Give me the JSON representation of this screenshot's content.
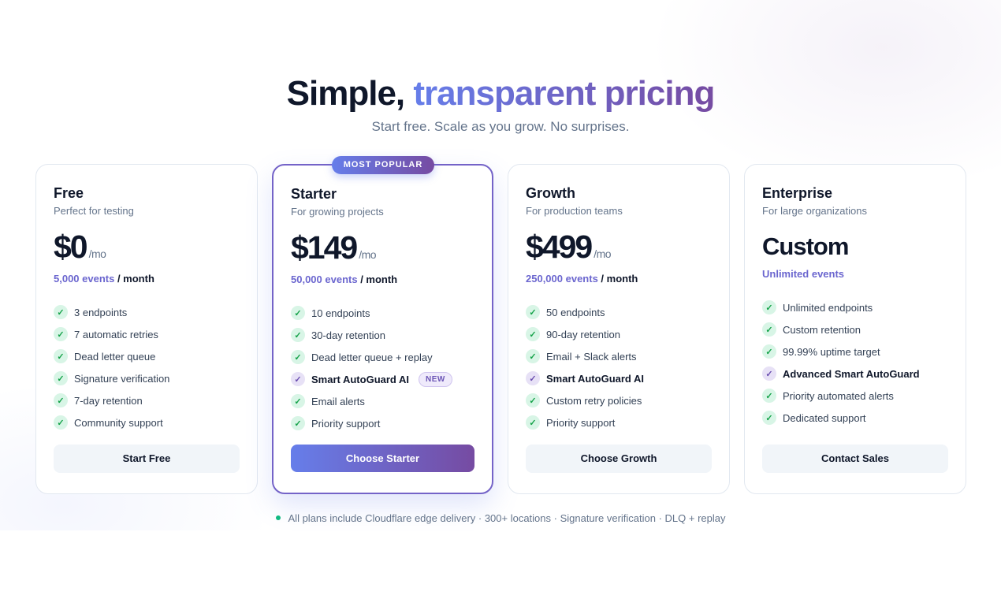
{
  "header": {
    "title_part1": "Simple, ",
    "title_part2": "transparent pricing",
    "subtitle": "Start free. Scale as you grow. No surprises."
  },
  "plans": [
    {
      "name": "Free",
      "description": "Perfect for testing",
      "price": "$0",
      "per": "/mo",
      "events_count": "5,000 events",
      "events_period": " / month",
      "features": [
        "3 endpoints",
        "7 automatic retries",
        "Dead letter queue",
        "Signature verification",
        "7-day retention",
        "Community support"
      ],
      "cta": "Start Free"
    },
    {
      "name": "Starter",
      "badge": "MOST POPULAR",
      "description": "For growing projects",
      "price": "$149",
      "per": "/mo",
      "events_count": "50,000 events",
      "events_period": " / month",
      "features": [
        "10 endpoints",
        "30-day retention",
        "Dead letter queue + replay",
        "Smart AutoGuard AI",
        "Email alerts",
        "Priority support"
      ],
      "new_tag": "NEW",
      "cta": "Choose Starter"
    },
    {
      "name": "Growth",
      "description": "For production teams",
      "price": "$499",
      "per": "/mo",
      "events_count": "250,000 events",
      "events_period": " / month",
      "features": [
        "50 endpoints",
        "90-day retention",
        "Email + Slack alerts",
        "Smart AutoGuard AI",
        "Custom retry policies",
        "Priority support"
      ],
      "cta": "Choose Growth"
    },
    {
      "name": "Enterprise",
      "description": "For large organizations",
      "price": "Custom",
      "events_count": "Unlimited events",
      "features": [
        "Unlimited endpoints",
        "Custom retention",
        "99.99% uptime target",
        "Advanced Smart AutoGuard",
        "Priority automated alerts",
        "Dedicated support"
      ],
      "cta": "Contact Sales"
    }
  ],
  "footer": {
    "note": "All plans include Cloudflare edge delivery · 300+ locations · Signature verification · DLQ + replay"
  },
  "colors": {
    "accent_start": "#667eea",
    "accent_end": "#764ba2",
    "check_green": "#16a34a",
    "status_dot": "#10b981"
  },
  "icons": {
    "check": "check-icon",
    "ai_check": "ai-check-icon",
    "status": "status-dot-icon"
  }
}
